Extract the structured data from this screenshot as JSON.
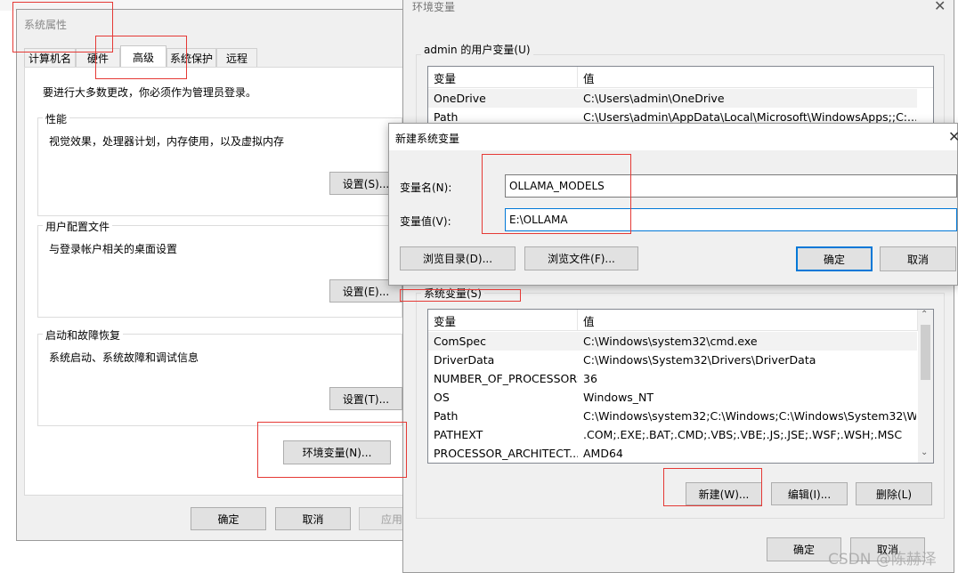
{
  "sys_props": {
    "title": "系统属性",
    "tabs": [
      "计算机名",
      "硬件",
      "高级",
      "系统保护",
      "远程"
    ],
    "admin_note": "要进行大多数更改，你必须作为管理员登录。",
    "perf": {
      "title": "性能",
      "desc": "视觉效果，处理器计划，内存使用，以及虚拟内存",
      "btn": "设置(S)..."
    },
    "profile": {
      "title": "用户配置文件",
      "desc": "与登录帐户相关的桌面设置",
      "btn": "设置(E)..."
    },
    "startup": {
      "title": "启动和故障恢复",
      "desc": "系统启动、系统故障和调试信息",
      "btn": "设置(T)..."
    },
    "env_btn": "环境变量(N)...",
    "ok": "确定",
    "cancel": "取消",
    "apply": "应用"
  },
  "env_vars": {
    "title": "环境变量",
    "user_group": "admin 的用户变量(U)",
    "col_var": "变量",
    "col_val": "值",
    "user_rows": [
      {
        "name": "OneDrive",
        "value": "C:\\Users\\admin\\OneDrive"
      },
      {
        "name": "Path",
        "value": "C:\\Users\\admin\\AppData\\Local\\Microsoft\\WindowsApps;;C:..."
      }
    ],
    "sys_group": "系统变量(S)",
    "sys_rows": [
      {
        "name": "ComSpec",
        "value": "C:\\Windows\\system32\\cmd.exe"
      },
      {
        "name": "DriverData",
        "value": "C:\\Windows\\System32\\Drivers\\DriverData"
      },
      {
        "name": "NUMBER_OF_PROCESSORS",
        "value": "36"
      },
      {
        "name": "OS",
        "value": "Windows_NT"
      },
      {
        "name": "Path",
        "value": "C:\\Windows\\system32;C:\\Windows;C:\\Windows\\System32\\Wb..."
      },
      {
        "name": "PATHEXT",
        "value": ".COM;.EXE;.BAT;.CMD;.VBS;.VBE;.JS;.JSE;.WSF;.WSH;.MSC"
      },
      {
        "name": "PROCESSOR_ARCHITECT...",
        "value": "AMD64"
      }
    ],
    "new_btn": "新建(W)...",
    "edit_btn": "编辑(I)...",
    "delete_btn": "删除(L)",
    "ok": "确定",
    "cancel": "取消"
  },
  "new_var": {
    "title": "新建系统变量",
    "name_label": "变量名(N):",
    "value_label": "变量值(V):",
    "name_value": "OLLAMA_MODELS",
    "value_value": "E:\\OLLAMA",
    "browse_dir": "浏览目录(D)...",
    "browse_file": "浏览文件(F)...",
    "ok": "确定",
    "cancel": "取消"
  },
  "watermark": "CSDN @陈赫泽"
}
